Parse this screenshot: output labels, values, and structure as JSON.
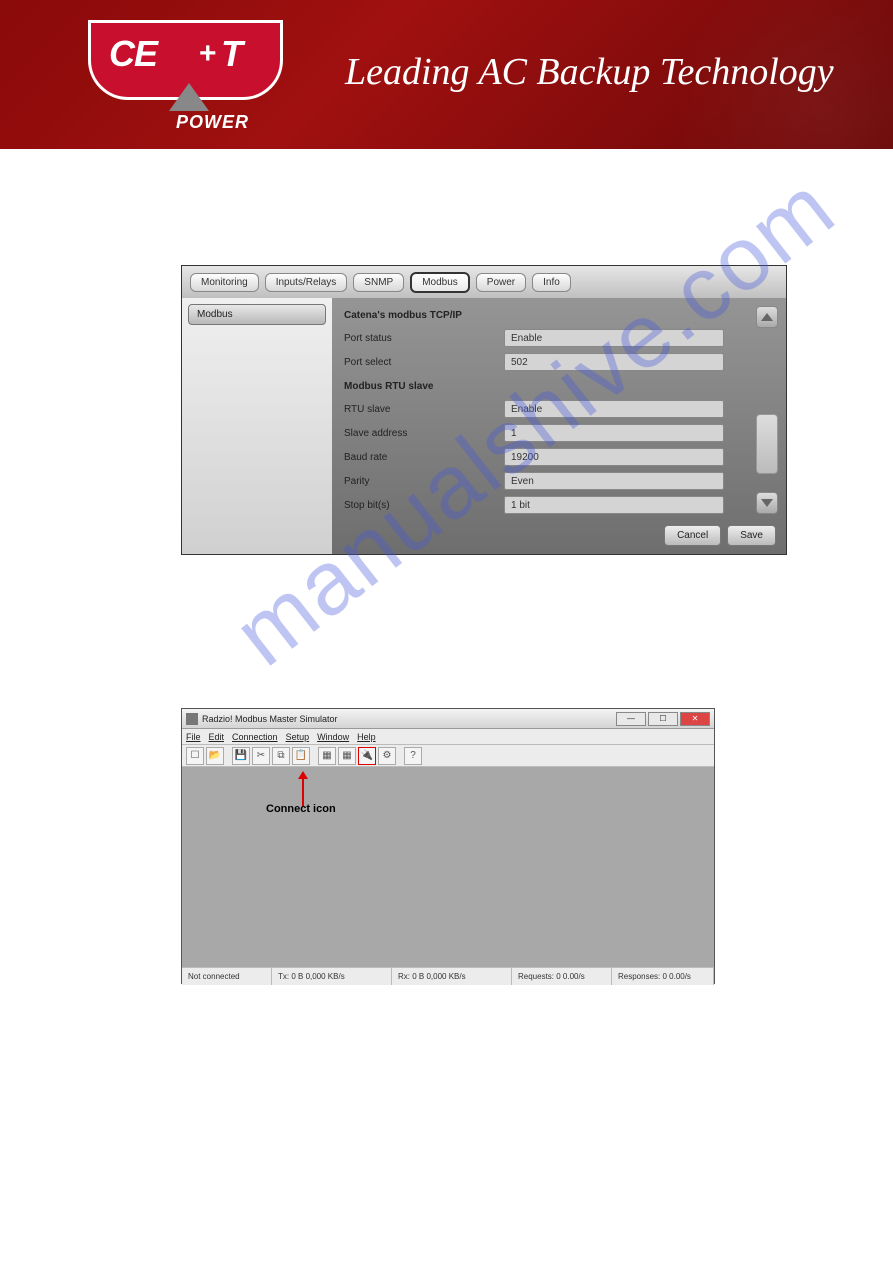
{
  "header": {
    "logo_main": "CE",
    "logo_plus": "+",
    "logo_t": "T",
    "logo_sub": "POWER",
    "tagline": "Leading AC Backup Technology"
  },
  "screenshot1": {
    "tabs": [
      "Monitoring",
      "Inputs/Relays",
      "SNMP",
      "Modbus",
      "Power",
      "Info"
    ],
    "active_tab_index": 3,
    "sidebar_item": "Modbus",
    "section1_title": "Catena's modbus TCP/IP",
    "section2_title": "Modbus RTU slave",
    "rows": [
      {
        "label": "Port status",
        "value": "Enable"
      },
      {
        "label": "Port select",
        "value": "502"
      }
    ],
    "rows2": [
      {
        "label": "RTU slave",
        "value": "Enable"
      },
      {
        "label": "Slave address",
        "value": "1"
      },
      {
        "label": "Baud rate",
        "value": "19200"
      },
      {
        "label": "Parity",
        "value": "Even"
      },
      {
        "label": "Stop bit(s)",
        "value": "1 bit"
      }
    ],
    "cancel_label": "Cancel",
    "save_label": "Save"
  },
  "watermark_text": "manualshive.com",
  "screenshot2": {
    "window_title": "Radzio! Modbus Master Simulator",
    "menus": [
      "File",
      "Edit",
      "Connection",
      "Setup",
      "Window",
      "Help"
    ],
    "toolbar_icons": [
      "new-icon",
      "open-icon",
      "save-icon",
      "cut-icon",
      "copy-icon",
      "paste-icon",
      "grid-icon",
      "grid2-icon",
      "connect-icon",
      "props-icon",
      "about-icon"
    ],
    "highlighted_icon_index": 8,
    "annotation": "Connect icon",
    "status": {
      "conn": "Not connected",
      "tx": "Tx: 0 B   0,000 KB/s",
      "rx": "Rx: 0 B   0,000 KB/s",
      "req": "Requests: 0   0.00/s",
      "resp": "Responses: 0   0.00/s"
    }
  }
}
